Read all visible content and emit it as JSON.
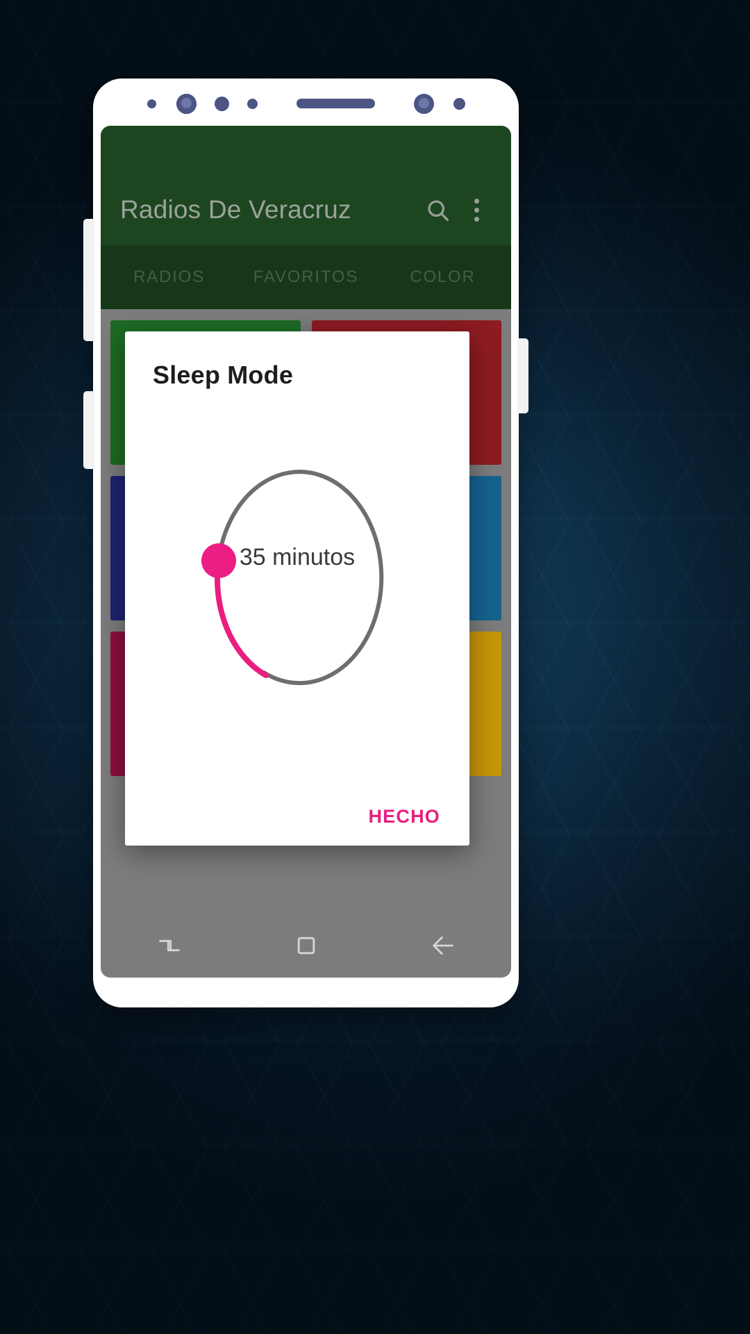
{
  "theme": {
    "appbar_green": "#1d4620",
    "tabbar_green": "#17371a",
    "accent_pink": "#e91e7f",
    "track_gray": "#6e6e6e",
    "screen_gray": "#7c7c7c",
    "backdrop_navy": "#0d2d45"
  },
  "appbar": {
    "title": "Radios De Veracruz",
    "search_icon": "search-icon",
    "overflow_icon": "overflow-menu-icon"
  },
  "tabs": [
    {
      "label": "RADIOS"
    },
    {
      "label": "FAVORITOS"
    },
    {
      "label": "COLOR"
    }
  ],
  "content": {
    "tiles": [
      [
        {
          "color": "#1d6b24"
        },
        {
          "color": "#8e1b22"
        }
      ],
      [
        {
          "color": "#1e2470"
        },
        {
          "color": "#15628f"
        }
      ],
      [
        {
          "color": "#8c0f3d"
        },
        {
          "color": "#c79608"
        }
      ]
    ]
  },
  "dialog": {
    "title": "Sleep Mode",
    "value_label": "35 minutos",
    "done_label": "HECHO",
    "slider": {
      "value": 35,
      "unit": "minutos",
      "min": 0,
      "max": 120,
      "track_color": "#6e6e6e",
      "progress_color": "#e91e7f",
      "thumb_color": "#ed1e83"
    }
  },
  "navbar": {
    "recents_icon": "recents-icon",
    "home_icon": "home-square-icon",
    "back_icon": "back-arrow-icon"
  }
}
